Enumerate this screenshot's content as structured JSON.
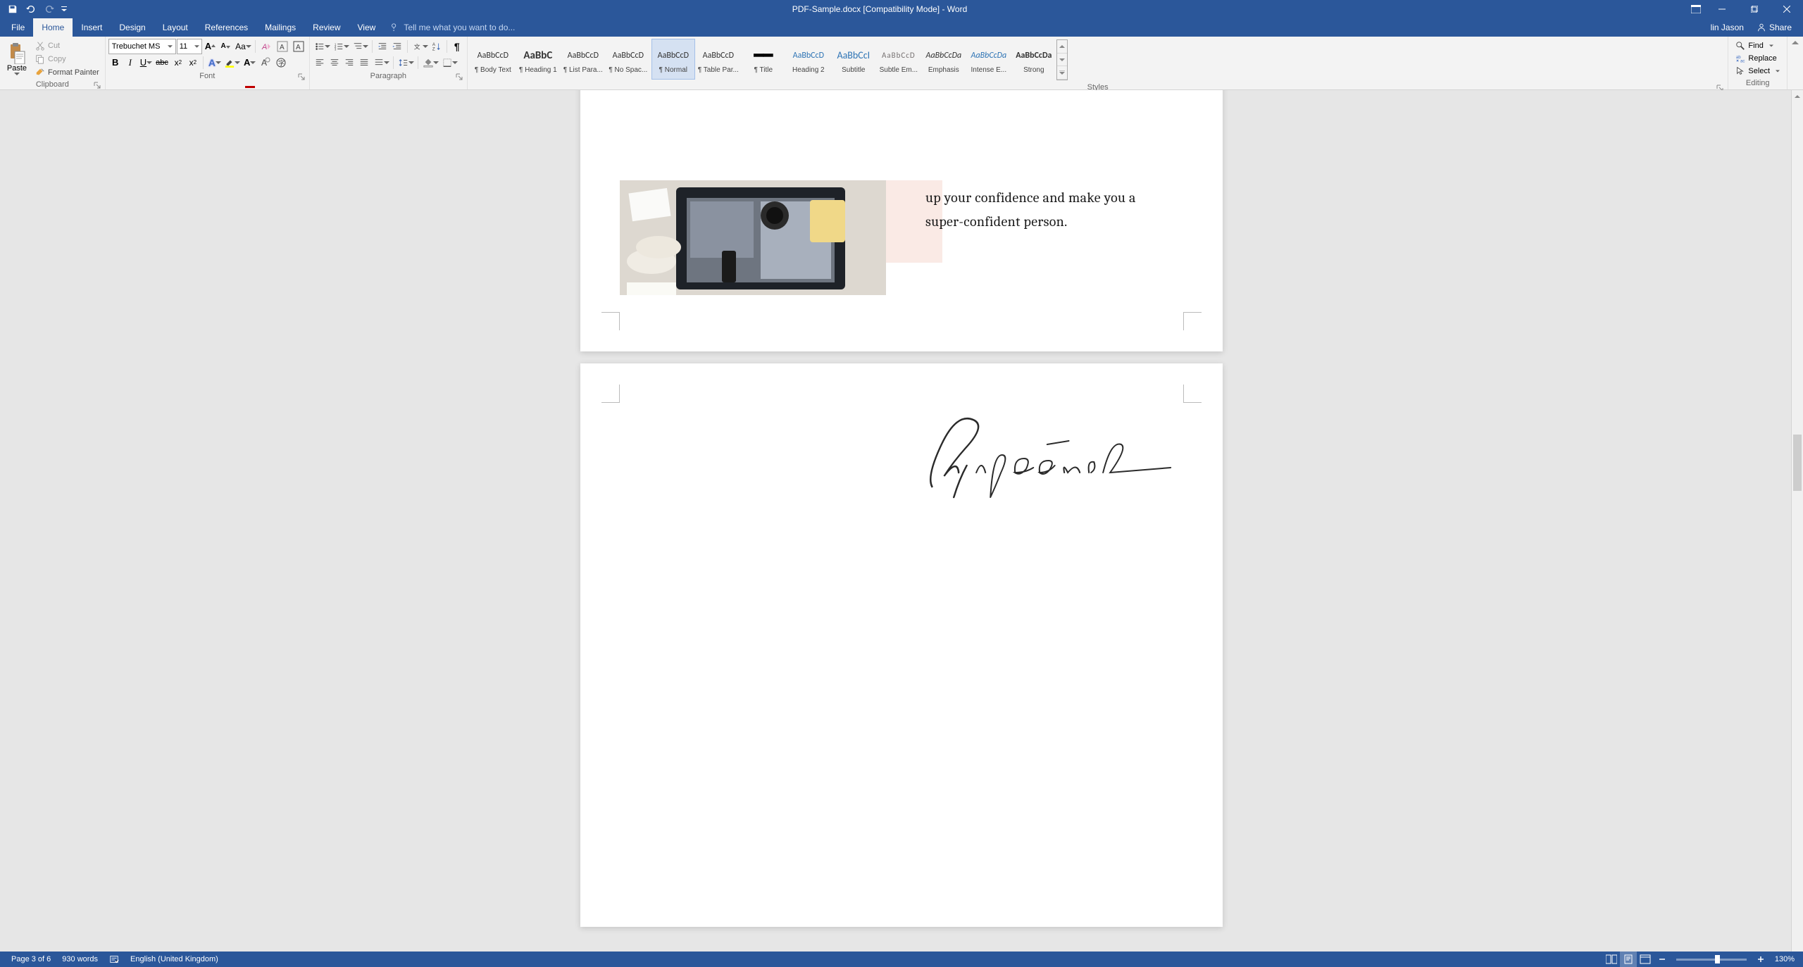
{
  "titlebar": {
    "title": "PDF-Sample.docx [Compatibility Mode] - Word"
  },
  "tabs": {
    "file": "File",
    "home": "Home",
    "insert": "Insert",
    "design": "Design",
    "layout": "Layout",
    "references": "References",
    "mailings": "Mailings",
    "review": "Review",
    "view": "View",
    "tellme_placeholder": "Tell me what you want to do..."
  },
  "user": {
    "name": "lin Jason",
    "share": "Share"
  },
  "clipboard": {
    "label": "Clipboard",
    "paste": "Paste",
    "cut": "Cut",
    "copy": "Copy",
    "format_painter": "Format Painter"
  },
  "font": {
    "label": "Font",
    "name": "Trebuchet MS",
    "size": "11"
  },
  "paragraph": {
    "label": "Paragraph"
  },
  "styles": {
    "label": "Styles",
    "items": [
      {
        "preview": "AaBbCcD",
        "name": "¶ Body Text",
        "style": "font-family:Calibri;"
      },
      {
        "preview": "AaBbC",
        "name": "¶ Heading 1",
        "style": "font-family:Calibri;font-weight:bold;font-size:15px;"
      },
      {
        "preview": "AaBbCcD",
        "name": "¶ List Para...",
        "style": "font-family:Calibri;"
      },
      {
        "preview": "AaBbCcD",
        "name": "¶ No Spac...",
        "style": "font-family:Calibri;"
      },
      {
        "preview": "AaBbCcD",
        "name": "¶ Normal",
        "style": "font-family:Calibri;"
      },
      {
        "preview": "AaBbCcD",
        "name": "¶ Table Par...",
        "style": "font-family:Calibri;"
      },
      {
        "preview": "━━",
        "name": "¶ Title",
        "style": "font-family:Calibri;font-size:22px;color:#000;font-weight:900;"
      },
      {
        "preview": "AaBbCcD",
        "name": "Heading 2",
        "style": "font-family:Calibri;color:#2e74b5;"
      },
      {
        "preview": "AaBbCcI",
        "name": "Subtitle",
        "style": "font-family:Calibri;color:#2e74b5;font-size:14px;"
      },
      {
        "preview": "AaBbCcD",
        "name": "Subtle Em...",
        "style": "font-family:Calibri;color:#767171;font-size:11px;letter-spacing:1px;"
      },
      {
        "preview": "AaBbCcDa",
        "name": "Emphasis",
        "style": "font-family:Calibri;font-style:italic;"
      },
      {
        "preview": "AaBbCcDa",
        "name": "Intense E...",
        "style": "font-family:Calibri;font-style:italic;color:#2e74b5;"
      },
      {
        "preview": "AaBbCcDa",
        "name": "Strong",
        "style": "font-family:Calibri;font-weight:bold;"
      }
    ],
    "active_index": 4
  },
  "editing": {
    "label": "Editing",
    "find": "Find",
    "replace": "Replace",
    "select": "Select"
  },
  "document": {
    "body_text": "up your confidence and make you a super-confident person.",
    "signature": "Signature"
  },
  "statusbar": {
    "page": "Page 3 of 6",
    "words": "930 words",
    "language": "English (United Kingdom)",
    "zoom": "130%"
  }
}
